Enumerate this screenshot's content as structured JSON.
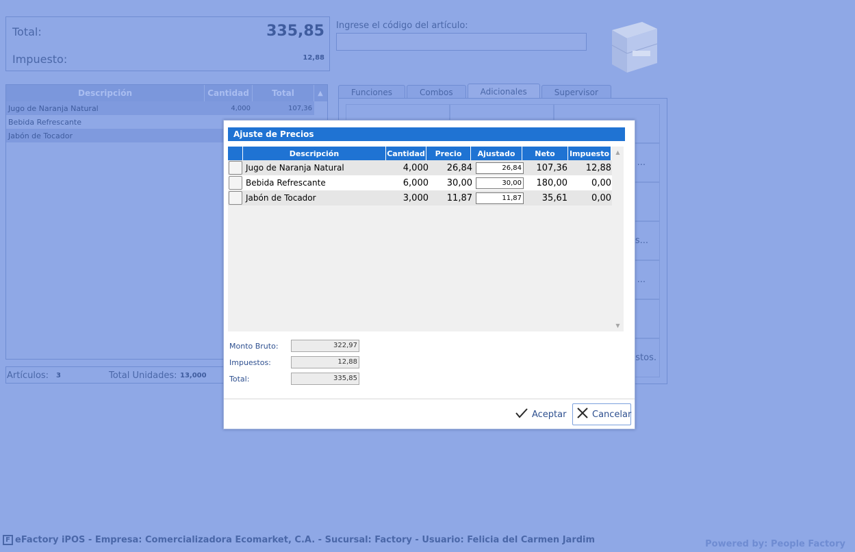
{
  "totals": {
    "total_label": "Total:",
    "total_value": "335,85",
    "tax_label": "Impuesto:",
    "tax_value": "12,88"
  },
  "code": {
    "label": "Ingrese el código del artículo:",
    "value": ""
  },
  "items_table": {
    "headers": [
      "Descripción",
      "Cantidad",
      "Total"
    ],
    "rows": [
      {
        "desc": "Jugo de Naranja Natural",
        "qty": "4,000",
        "total": "107,36"
      },
      {
        "desc": "Bebida Refrescante",
        "qty": "",
        "total": ""
      },
      {
        "desc": "Jabón de Tocador",
        "qty": "",
        "total": ""
      }
    ]
  },
  "summary": {
    "articles_label": "Artículos:",
    "articles_value": "3",
    "units_label": "Total Unidades:",
    "units_value": "13,000"
  },
  "tabs": [
    "Funciones",
    "Combos",
    "Adicionales",
    "Supervisor"
  ],
  "panel_fragments": [
    "...",
    "s...",
    "...",
    "stos."
  ],
  "footer": {
    "logo_letter": "F",
    "left": "eFactory iPOS - Empresa: Comercializadora Ecomarket, C.A. - Sucursal: Factory - Usuario: Felicia del Carmen Jardim",
    "right": "Powered by: People Factory"
  },
  "modal": {
    "title": "Ajuste de Precios",
    "columns": [
      "Descripción",
      "Cantidad",
      "Precio",
      "Ajustado",
      "Neto",
      "Impuesto"
    ],
    "rows": [
      {
        "desc": "Jugo de Naranja Natural",
        "qty": "4,000",
        "price": "26,84",
        "adjusted": "26,84",
        "net": "107,36",
        "tax": "12,88"
      },
      {
        "desc": "Bebida Refrescante",
        "qty": "6,000",
        "price": "30,00",
        "adjusted": "30,00",
        "net": "180,00",
        "tax": "0,00"
      },
      {
        "desc": "Jabón de Tocador",
        "qty": "3,000",
        "price": "11,87",
        "adjusted": "11,87",
        "net": "35,61",
        "tax": "0,00"
      }
    ],
    "gross_label": "Monto Bruto:",
    "gross_value": "322,97",
    "taxes_label": "Impuestos:",
    "taxes_value": "12,88",
    "total_label": "Total:",
    "total_value": "335,85",
    "accept_label": "Aceptar",
    "cancel_label": "Cancelar"
  },
  "colors": {
    "accent": "#1f73d3",
    "backdrop": "#8fa8e6"
  },
  "icons": [
    "check-icon",
    "close-icon",
    "product-image",
    "logo-icon"
  ]
}
